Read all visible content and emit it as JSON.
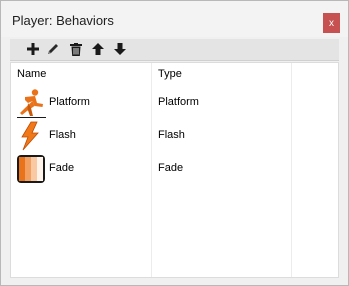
{
  "window": {
    "title": "Player: Behaviors",
    "close_label": "x"
  },
  "toolbar": {
    "buttons": [
      {
        "name": "add",
        "icon": "plus-icon"
      },
      {
        "name": "edit",
        "icon": "pencil-icon"
      },
      {
        "name": "delete",
        "icon": "trash-icon"
      },
      {
        "name": "move-up",
        "icon": "arrow-up-icon"
      },
      {
        "name": "move-down",
        "icon": "arrow-down-icon"
      }
    ]
  },
  "list": {
    "columns": [
      "Name",
      "Type"
    ],
    "rows": [
      {
        "name": "Platform",
        "type": "Platform",
        "icon": "platform-runner-icon"
      },
      {
        "name": "Flash",
        "type": "Flash",
        "icon": "lightning-icon"
      },
      {
        "name": "Fade",
        "type": "Fade",
        "icon": "fade-gradient-icon"
      }
    ]
  },
  "colors": {
    "close": "#c75050",
    "accent_orange": "#e8731a"
  }
}
